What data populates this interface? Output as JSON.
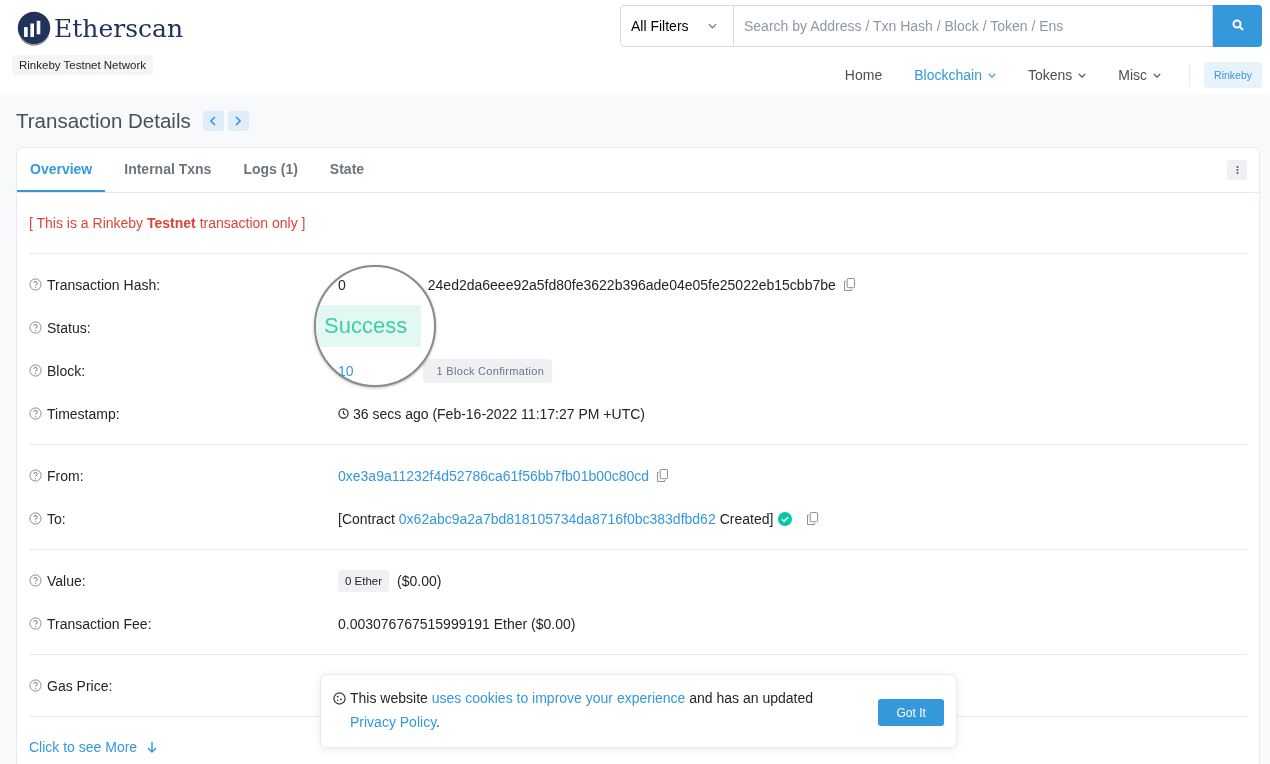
{
  "header": {
    "logo_text": "Etherscan",
    "network_badge": "Rinkeby Testnet Network",
    "filter": "All Filters",
    "search_placeholder": "Search by Address / Txn Hash / Block / Token / Ens",
    "nav": [
      {
        "label": "Home",
        "selected": false,
        "dropdown": false
      },
      {
        "label": "Blockchain",
        "selected": true,
        "dropdown": true
      },
      {
        "label": "Tokens",
        "selected": false,
        "dropdown": true
      },
      {
        "label": "Misc",
        "selected": false,
        "dropdown": true
      }
    ],
    "network_button": "Rinkeby"
  },
  "page_title": "Transaction Details",
  "tabs": [
    {
      "label": "Overview",
      "selected": true
    },
    {
      "label": "Internal Txns",
      "selected": false
    },
    {
      "label": "Logs (1)",
      "selected": false
    },
    {
      "label": "State",
      "selected": false
    }
  ],
  "notice": "[ This is a Rinkeby **Testnet** transaction only ]",
  "sections": [
    {
      "rows": [
        {
          "kind": "hash",
          "label": "Transaction Hash:",
          "value_start": "0",
          "value_end": "24ed2da6eee92a5fd80fe3622b396ade04e05fe25022eb15cbb7be"
        },
        {
          "kind": "empty",
          "label": "Status:"
        },
        {
          "kind": "block",
          "label": "Block:",
          "link": "10",
          "badge": "1 Block Confirmation"
        },
        {
          "kind": "timestamp",
          "label": "Timestamp:",
          "value": "36 secs ago (Feb-16-2022 11:17:27 PM +UTC)"
        }
      ]
    },
    {
      "rows": [
        {
          "kind": "address",
          "label": "From:",
          "link": "0xe3a9a11232f4d52786ca61f56bb7fb01b00c80cd"
        },
        {
          "kind": "contract",
          "label": "To:",
          "prefix": "[Contract",
          "link": "0x62abc9a2a7bd818105734da8716f0bc383dfbd62",
          "suffix": "Created]"
        }
      ]
    },
    {
      "rows": [
        {
          "kind": "value",
          "label": "Value:",
          "badge": "0 Ether",
          "value": "($0.00)"
        },
        {
          "kind": "text",
          "label": "Transaction Fee:",
          "value": "0.003076767515999191 Ether ($0.00)"
        }
      ]
    },
    {
      "rows": [
        {
          "kind": "empty",
          "label": "Gas Price:"
        }
      ]
    }
  ],
  "magnifier": {
    "status": "Success"
  },
  "more_link": "Click to see More",
  "cookie": {
    "text_start": "This website",
    "link1": "uses cookies to improve your experience",
    "text_mid": "and has an updated",
    "link2": "Privacy Policy",
    "text_end": ".",
    "button": "Got It"
  }
}
